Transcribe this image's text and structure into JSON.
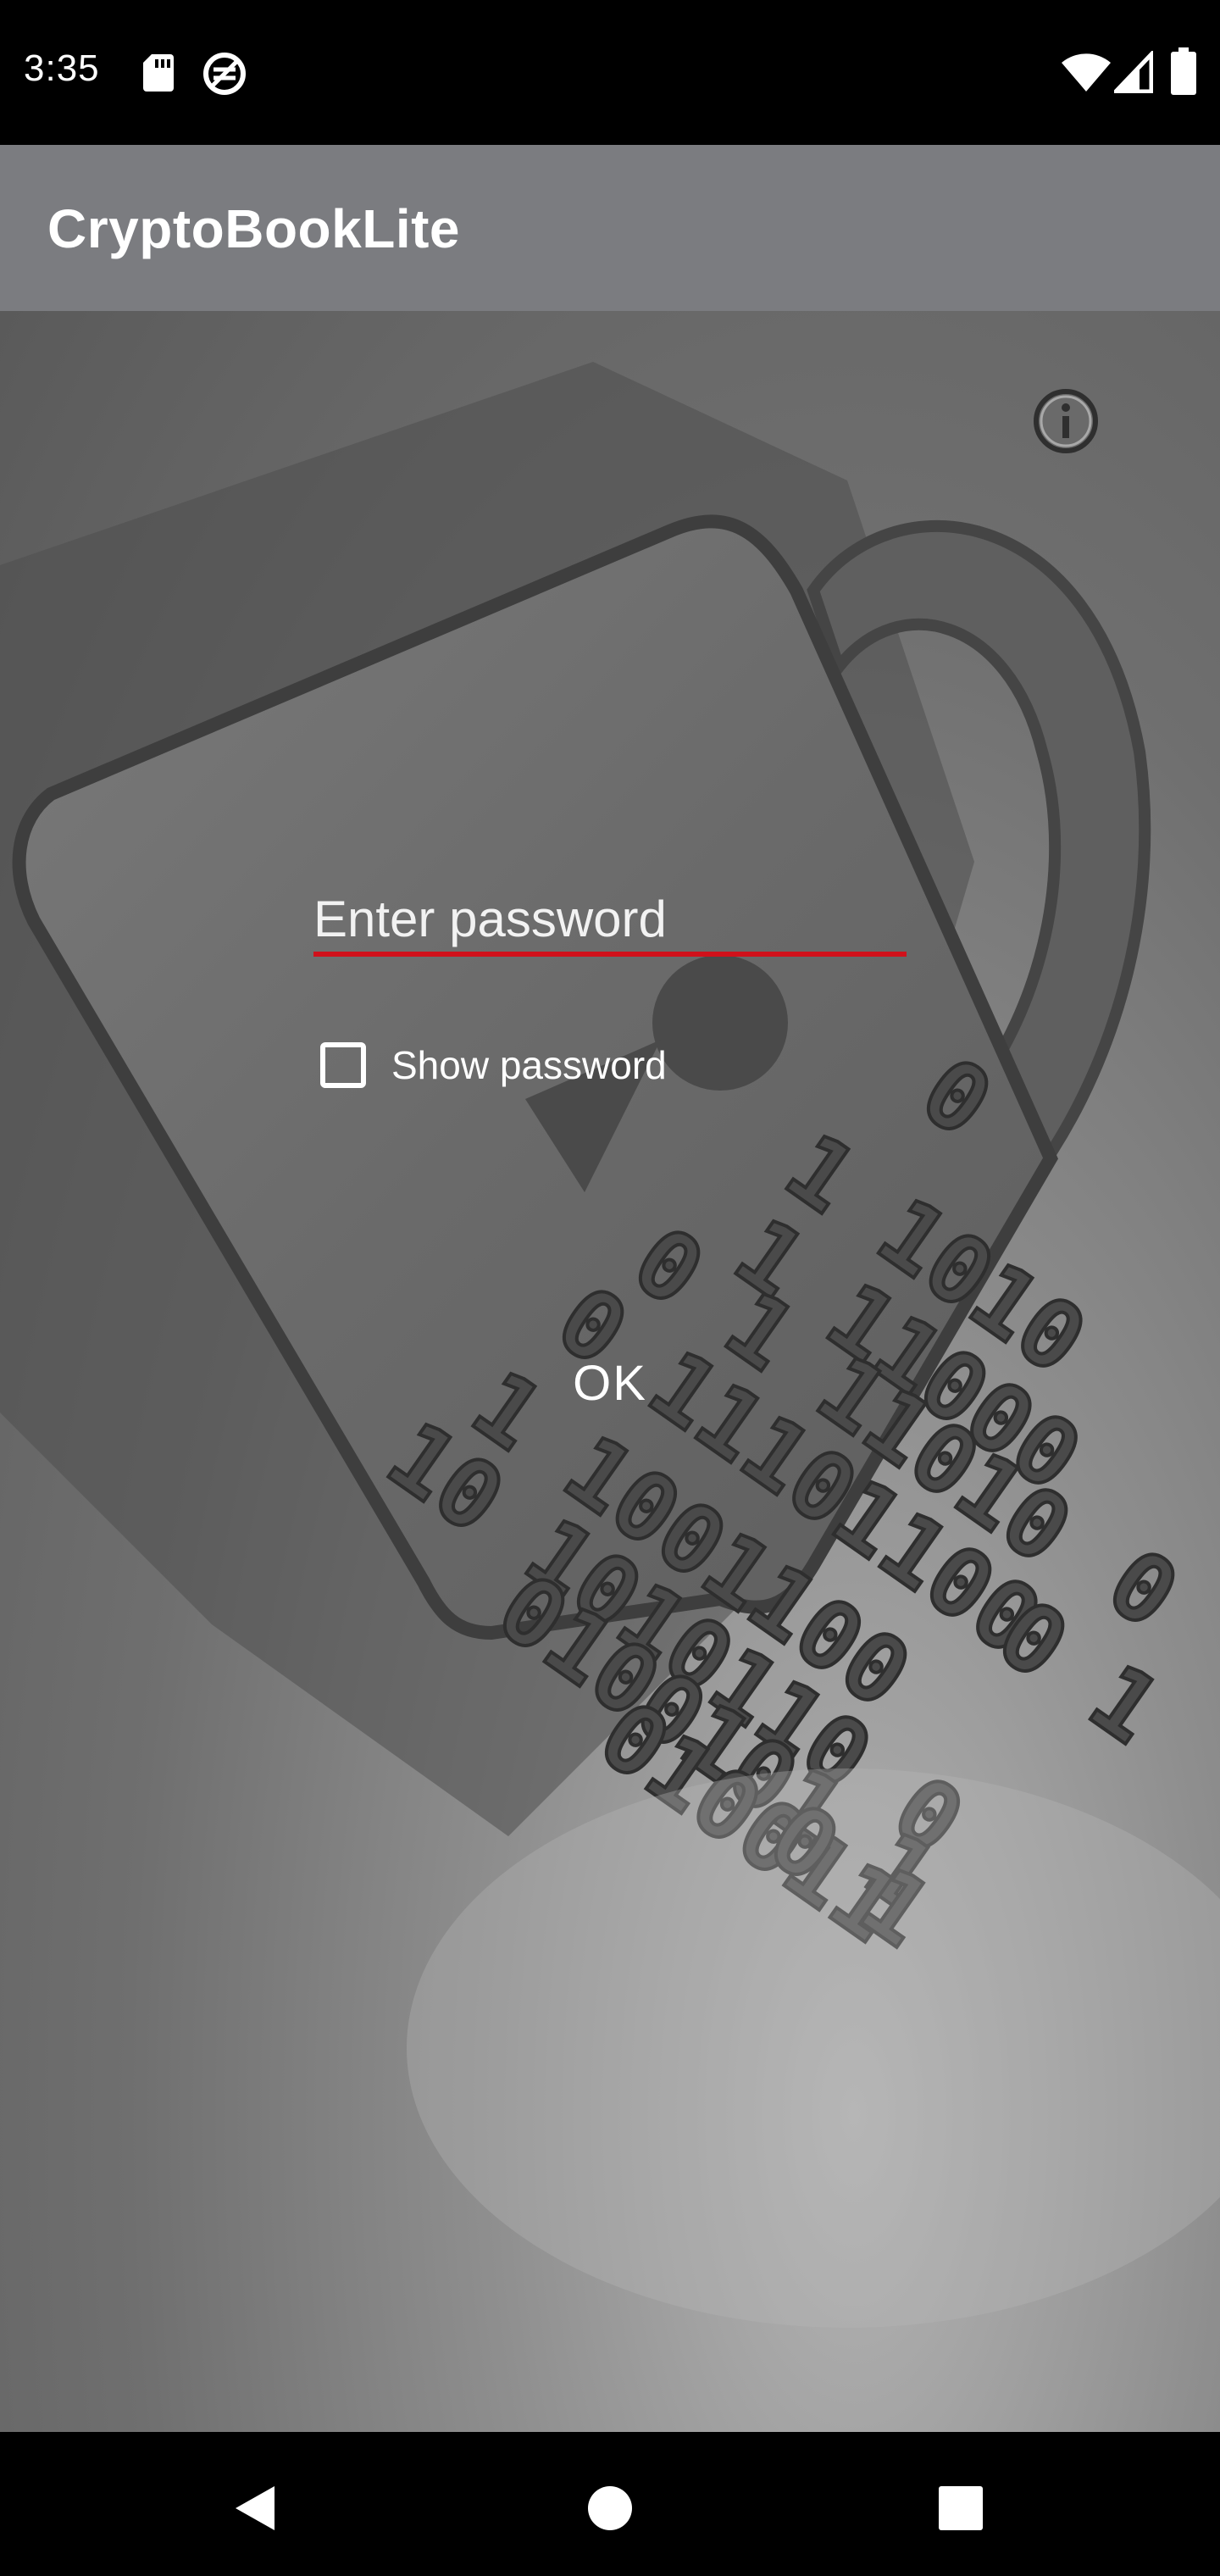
{
  "status_bar": {
    "time": "3:35",
    "icons": [
      "sd-card-icon",
      "sync-icon",
      "wifi-icon",
      "signal-icon",
      "battery-icon"
    ]
  },
  "app_bar": {
    "title": "CryptoBookLite"
  },
  "main": {
    "info_icon": "info-icon",
    "password_placeholder": "Enter password",
    "password_value": "",
    "show_password_label": "Show password",
    "show_password_checked": false,
    "ok_label": "OK",
    "accent_color": "#d0111b"
  },
  "nav_bar": {
    "icons": [
      "back-icon",
      "home-icon",
      "recents-icon"
    ]
  }
}
